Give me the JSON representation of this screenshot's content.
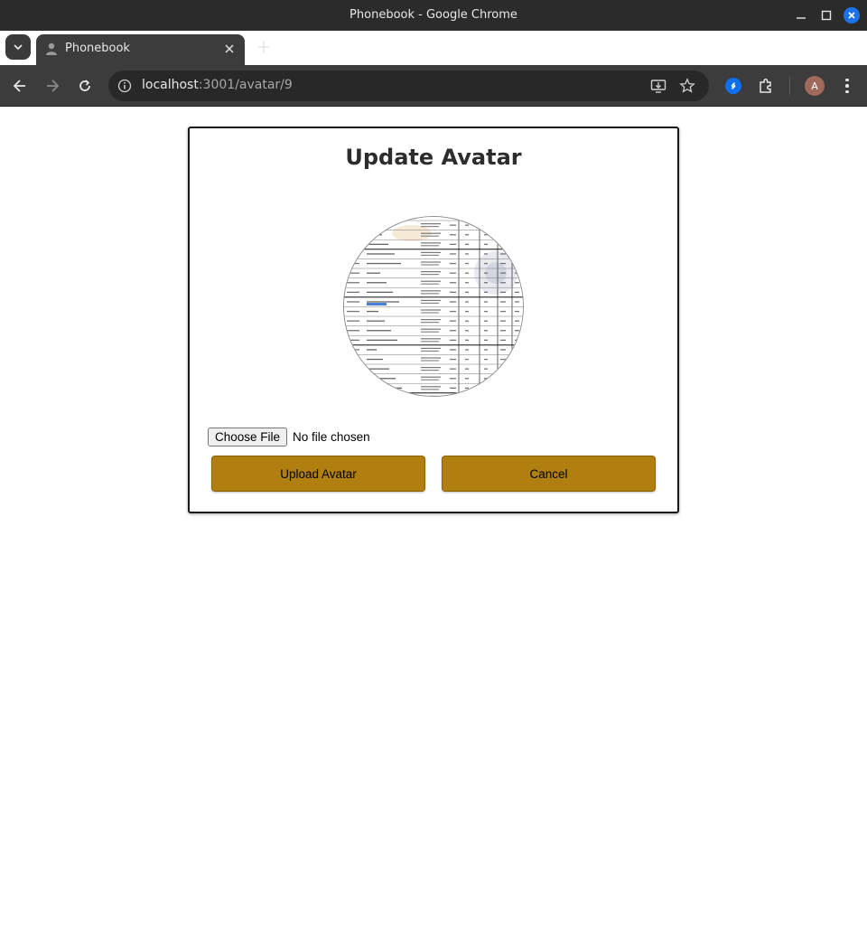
{
  "window": {
    "title": "Phonebook - Google Chrome"
  },
  "tab": {
    "title": "Phonebook"
  },
  "address_bar": {
    "host": "localhost",
    "path": ":3001/avatar/9"
  },
  "profile": {
    "initial": "A"
  },
  "page": {
    "heading": "Update Avatar",
    "file_input": {
      "button_label": "Choose File",
      "status": "No file chosen"
    },
    "buttons": {
      "upload": "Upload Avatar",
      "cancel": "Cancel"
    }
  },
  "colors": {
    "button_bg": "#b07f0f",
    "title_bar": "#2b2b2b",
    "toolbar": "#3c3c3c"
  }
}
